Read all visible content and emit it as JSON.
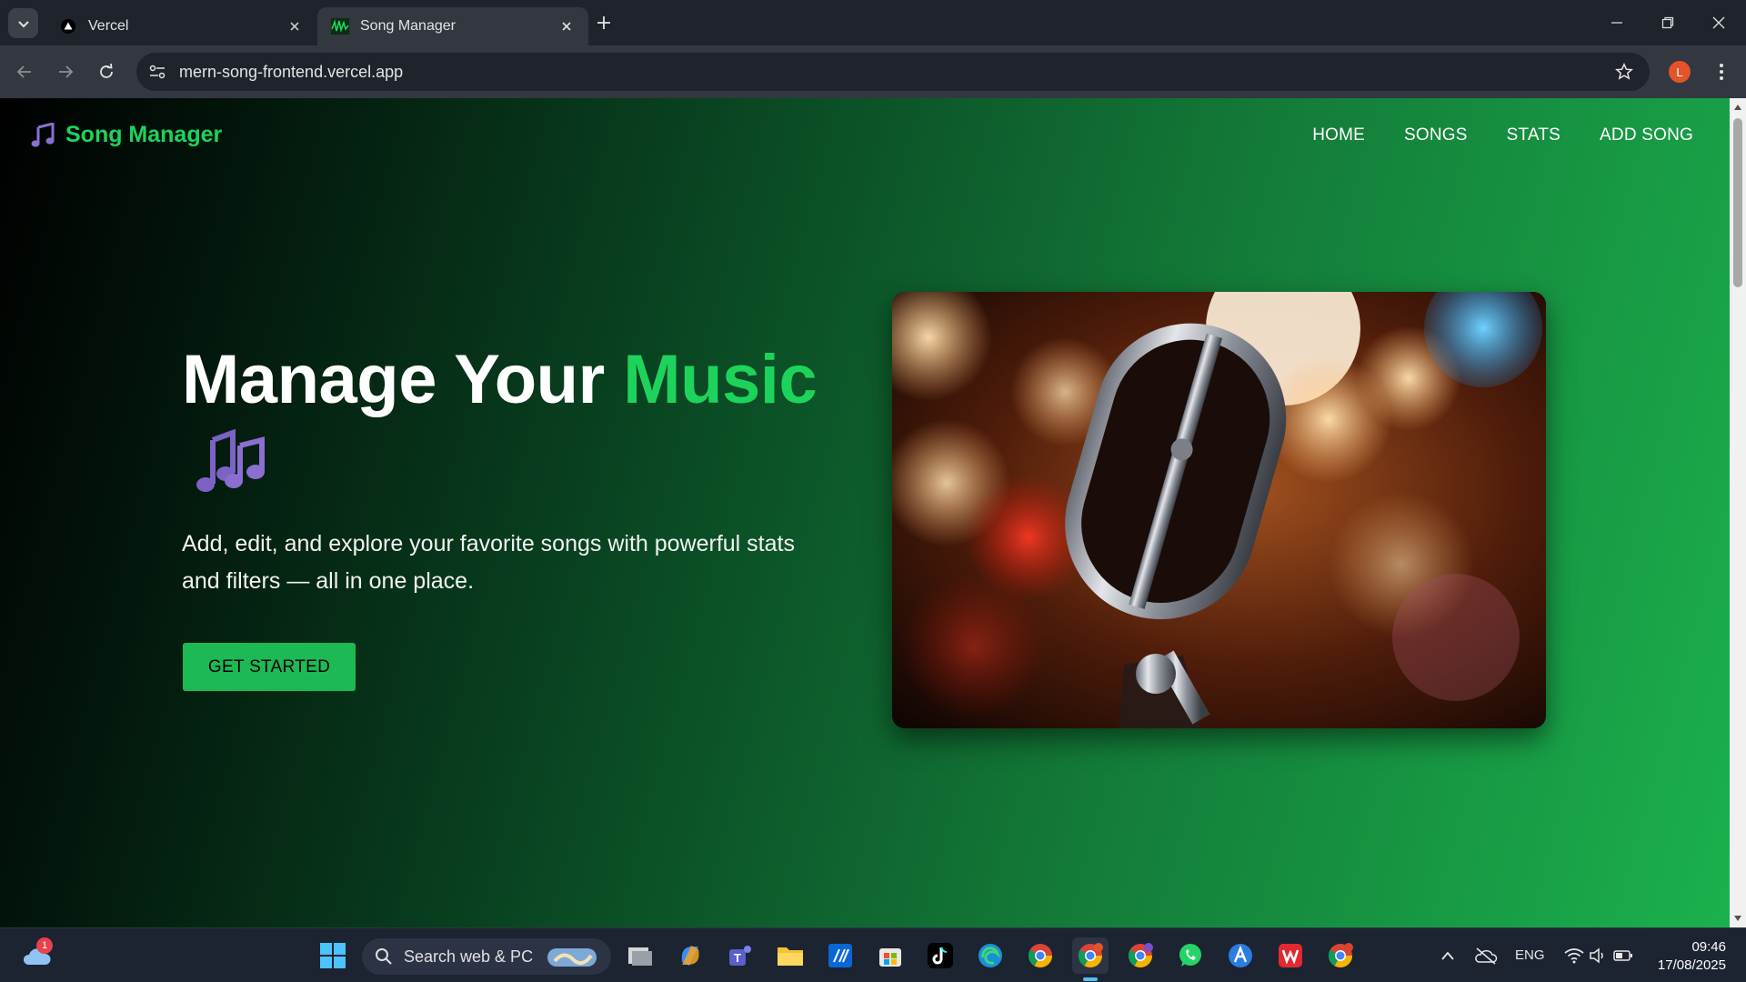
{
  "browser": {
    "tabs": [
      {
        "title": "Vercel",
        "icon": "vercel-triangle-icon",
        "active": false
      },
      {
        "title": "Song Manager",
        "icon": "song-manager-favicon",
        "active": true
      }
    ],
    "url": "mern-song-frontend.vercel.app",
    "profile_initial": "L"
  },
  "page": {
    "brand": "Song Manager",
    "nav": [
      "HOME",
      "SONGS",
      "STATS",
      "ADD SONG"
    ],
    "hero": {
      "title_main": "Manage Your ",
      "title_accent": "Music",
      "emoji": "🎶",
      "description": "Add, edit, and explore your favorite songs with powerful stats and filters — all in one place.",
      "cta": "GET STARTED",
      "image": "vintage-microphone-photo"
    },
    "colors": {
      "accent": "#1ed35b",
      "button": "#1db954",
      "note_icon": "#8a6fd1"
    }
  },
  "taskbar": {
    "search_placeholder": "Search web & PC",
    "weather_badge": "1",
    "language": "ENG",
    "time": "09:46",
    "date": "17/08/2025",
    "pinned": [
      "file-explorer-icon",
      "copilot-icon",
      "teams-icon",
      "folder-icon",
      "code-icon",
      "store-icon",
      "tiktok-icon",
      "edge-icon",
      "chrome-icon",
      "chrome-profile-l-icon",
      "chrome-profile-j-icon",
      "whatsapp-icon",
      "app-a-icon",
      "wps-icon",
      "chrome-profile-b-icon"
    ]
  }
}
